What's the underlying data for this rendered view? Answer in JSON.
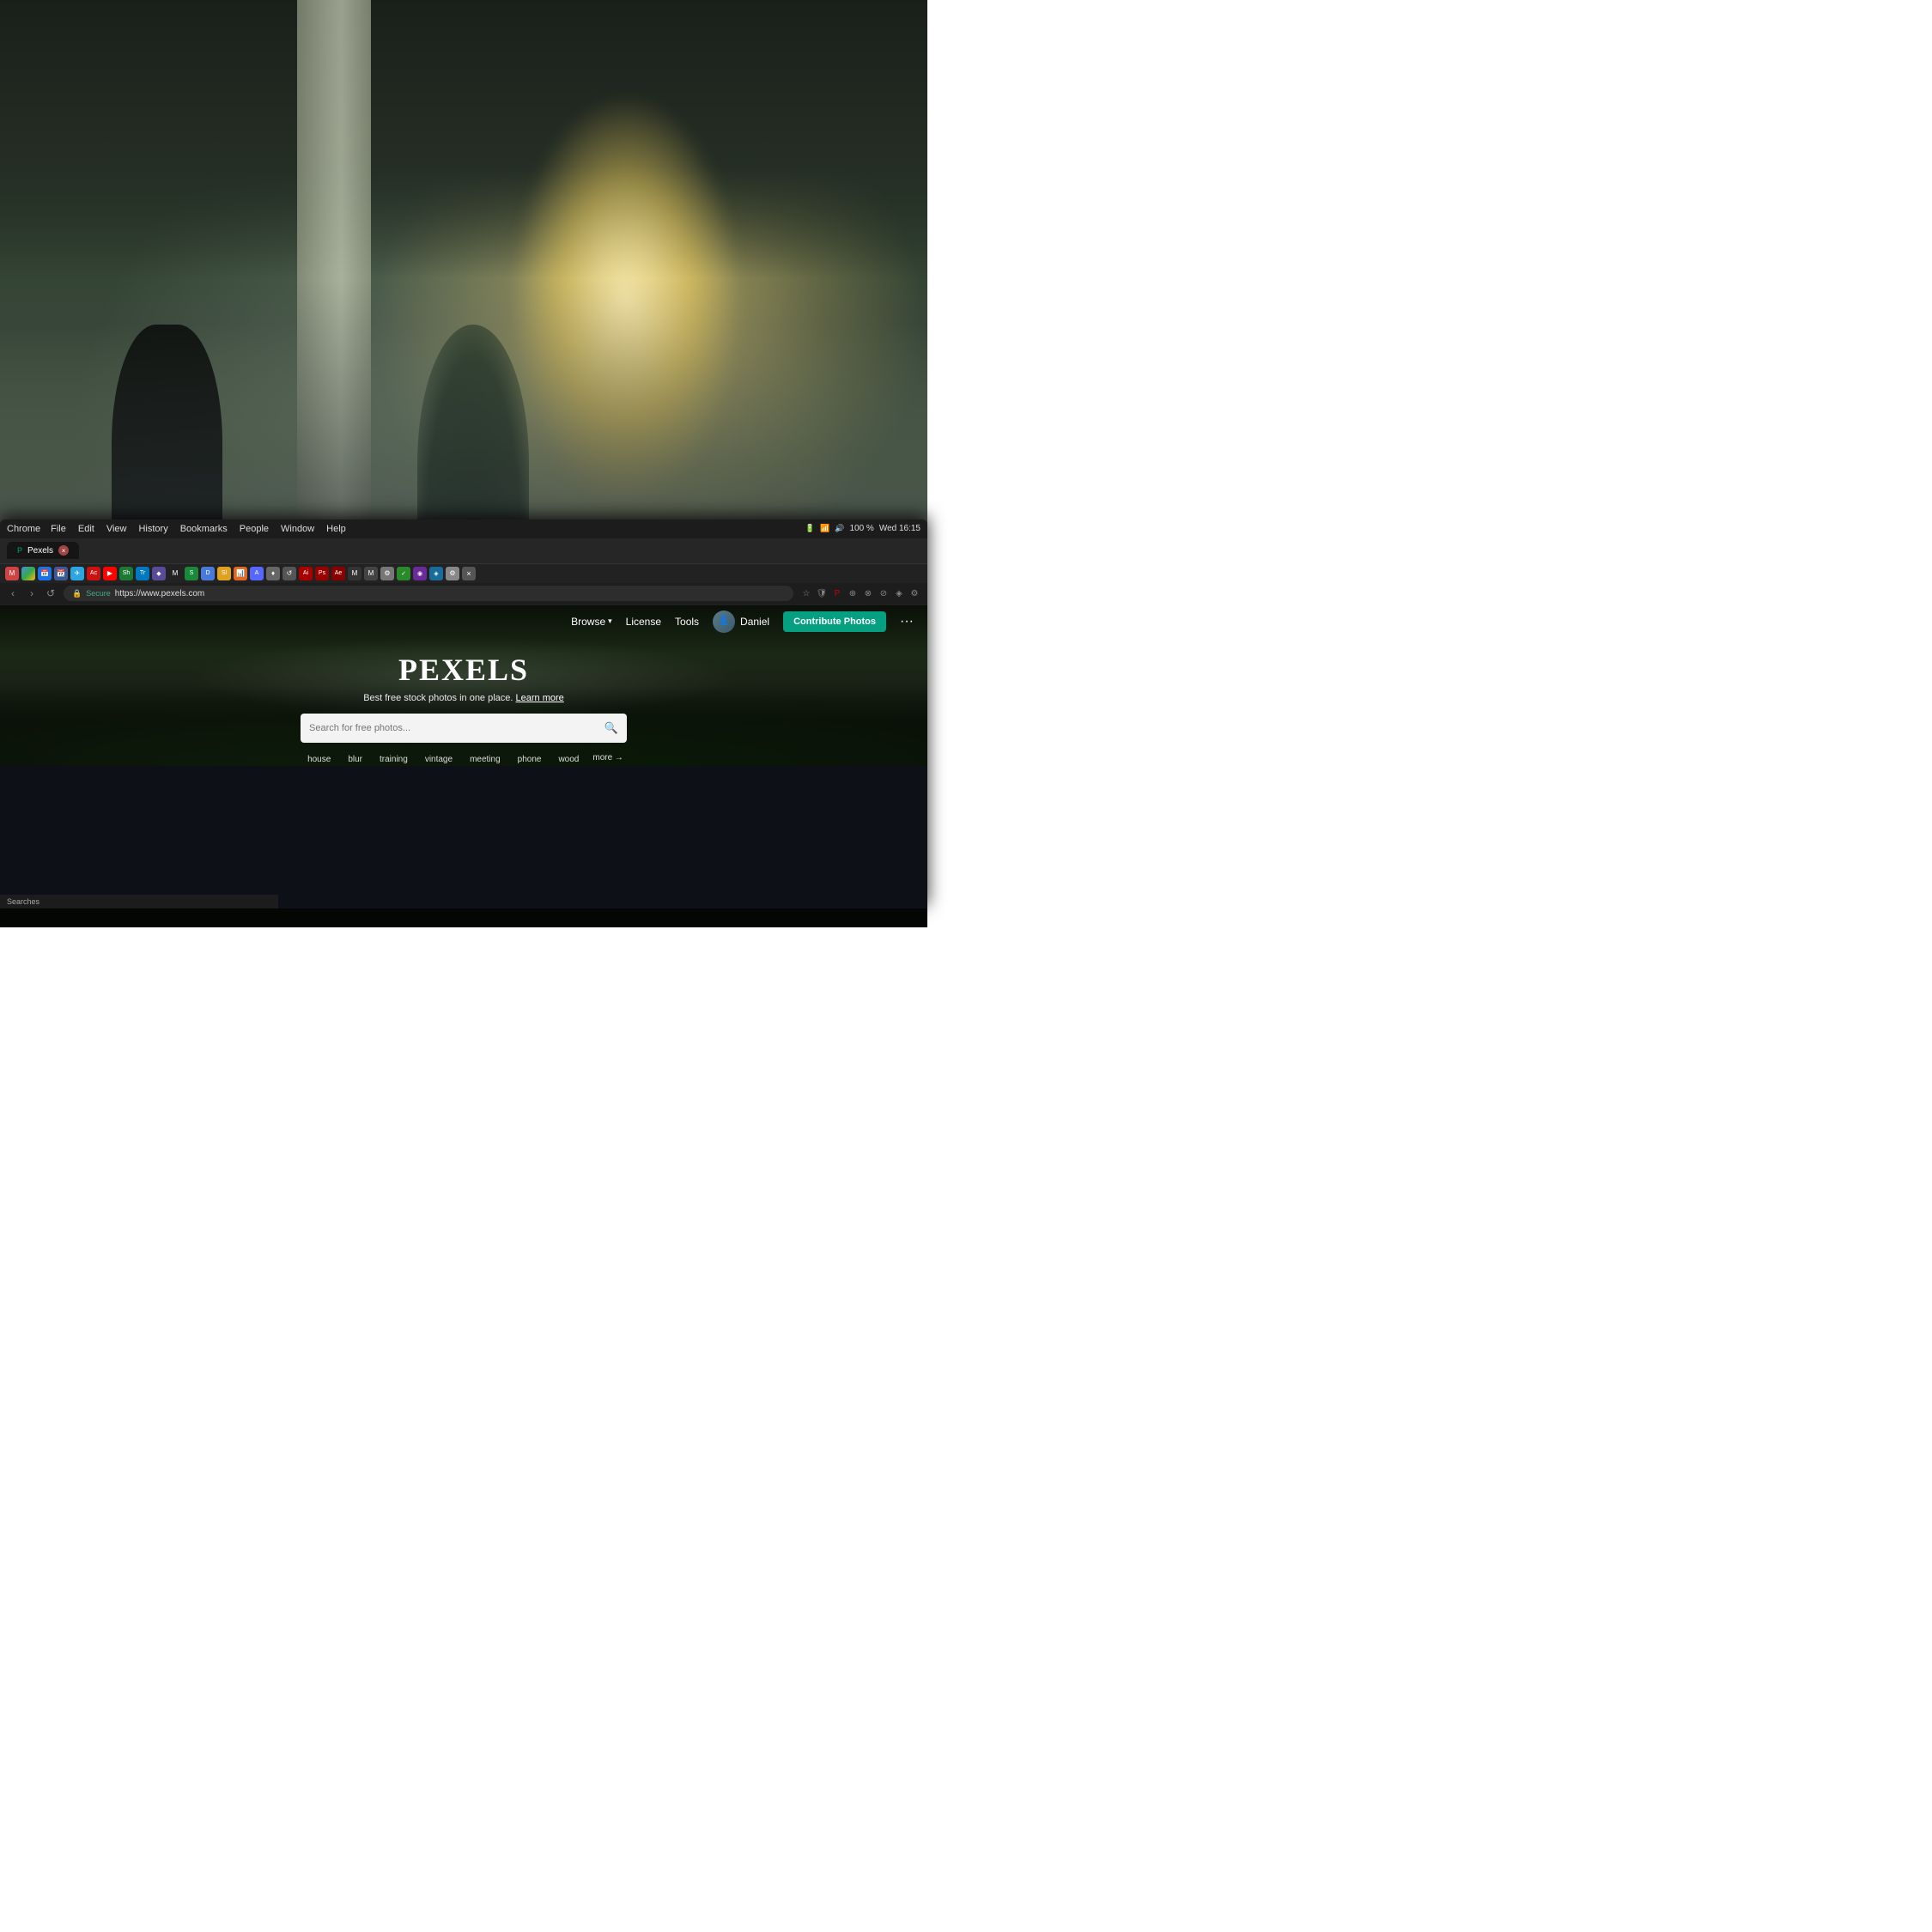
{
  "background": {
    "description": "Office space with natural light, columns, plants, person silhouette"
  },
  "os": {
    "menubar": {
      "app_name": "Chrome",
      "menu_items": [
        "File",
        "Edit",
        "View",
        "History",
        "Bookmarks",
        "People",
        "Window",
        "Help"
      ],
      "right_items": [
        "100 %",
        "Wed 16:15"
      ]
    },
    "statusbar": {
      "text": "Searches"
    }
  },
  "browser": {
    "tab": {
      "label": "Pexels",
      "url": "https://www.pexels.com"
    },
    "address_bar": {
      "secure_label": "Secure",
      "url": "https://www.pexels.com"
    }
  },
  "pexels": {
    "nav": {
      "browse_label": "Browse",
      "license_label": "License",
      "tools_label": "Tools",
      "username": "Daniel",
      "contribute_label": "Contribute Photos",
      "more_icon": "•••"
    },
    "hero": {
      "logo": "PEXELS",
      "tagline": "Best free stock photos in one place.",
      "learn_more": "Learn more",
      "search_placeholder": "Search for free photos...",
      "tags": [
        "house",
        "blur",
        "training",
        "vintage",
        "meeting",
        "phone",
        "wood"
      ],
      "more_tag": "more →"
    }
  }
}
